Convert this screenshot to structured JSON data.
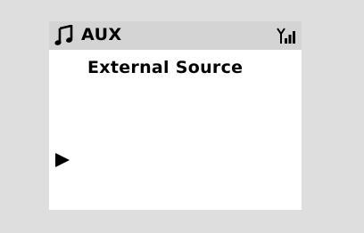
{
  "display": {
    "title": "AUX",
    "subtitle": "External Source",
    "icons": {
      "source": "music-note-icon",
      "signal": "wifi-signal-icon",
      "cursor": "play-arrow-icon"
    },
    "colors": {
      "background": "#dedede",
      "screen": "#ffffff",
      "title_bar": "#d4d4d4",
      "text": "#000000"
    }
  }
}
